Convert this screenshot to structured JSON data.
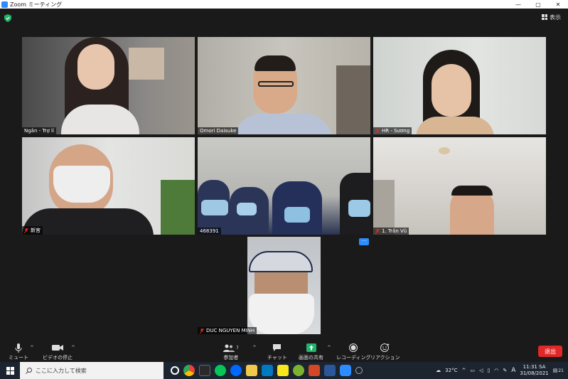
{
  "window": {
    "title": "Zoom ミーティング",
    "minimize": "—",
    "maximize": "▢",
    "close": "✕"
  },
  "header": {
    "view_label": "表示"
  },
  "participants": [
    {
      "name": "Ngân - Trợ lí",
      "muted": false,
      "active_speaker": true
    },
    {
      "name": "Omori Daisuke",
      "muted": false
    },
    {
      "name": "HR - Sương",
      "muted": true
    },
    {
      "name": "新宮",
      "muted": true
    },
    {
      "name": "468391",
      "muted": false
    },
    {
      "name": "1. Trần Vũ",
      "muted": true
    },
    {
      "name": "DUC NGUYEN MINH",
      "muted": true
    }
  ],
  "more_button": "···",
  "toolbar": {
    "mute": "ミュート",
    "video": "ビデオの停止",
    "participants": "参加者",
    "participants_count": "7",
    "chat": "チャット",
    "share": "画面の共有",
    "record": "レコーディング",
    "reactions": "リアクション",
    "leave": "退出"
  },
  "taskbar": {
    "search_placeholder": "ここに入力して検索",
    "weather": "32°C",
    "ime": "A",
    "time": "11:31 SA",
    "date": "31/08/2021",
    "notifications": "21"
  },
  "colors": {
    "accent": "#2d8cff",
    "active_border": "#e6e98a",
    "leave": "#e02828"
  }
}
